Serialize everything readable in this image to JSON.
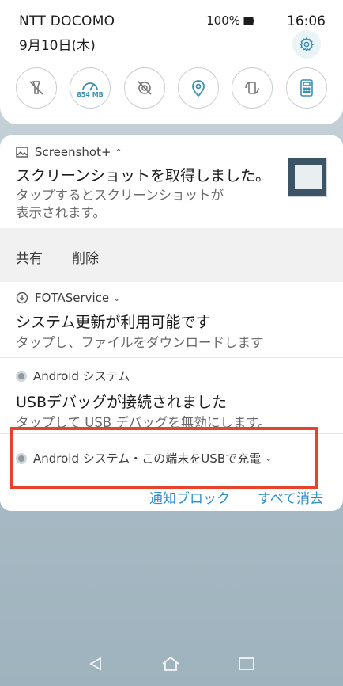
{
  "status_bar": {
    "carrier": "NTT DOCOMO",
    "battery": "100%",
    "time": "16:06"
  },
  "quick_settings": {
    "date": "9月10日(木)",
    "data_usage": "854 MB",
    "tiles": [
      "flashlight-off-icon",
      "data-usage-icon",
      "location-off-icon",
      "location-icon",
      "screen-rotate-icon",
      "calculator-icon"
    ]
  },
  "notifications": {
    "screenshot": {
      "app": "Screenshot+",
      "title": "スクリーンショットを取得しました。",
      "body1": "タップするとスクリーンショットが",
      "body2": "表示されます。",
      "action_share": "共有",
      "action_delete": "削除"
    },
    "fota": {
      "app": "FOTAService",
      "title": "システム更新が利用可能です",
      "body": "タップし、ファイルをダウンロードします"
    },
    "usb_debug": {
      "app": "Android システム",
      "title": "USBデバッグが接続されました",
      "body": "タップして USB デバッグを無効にします。"
    },
    "usb_charge": {
      "app": "Android システム・この端末をUSBで充電"
    }
  },
  "footer": {
    "block": "通知ブロック",
    "clear_all": "すべて消去"
  },
  "colors": {
    "accent": "#2f8fc9",
    "highlight": "#e5432b"
  }
}
